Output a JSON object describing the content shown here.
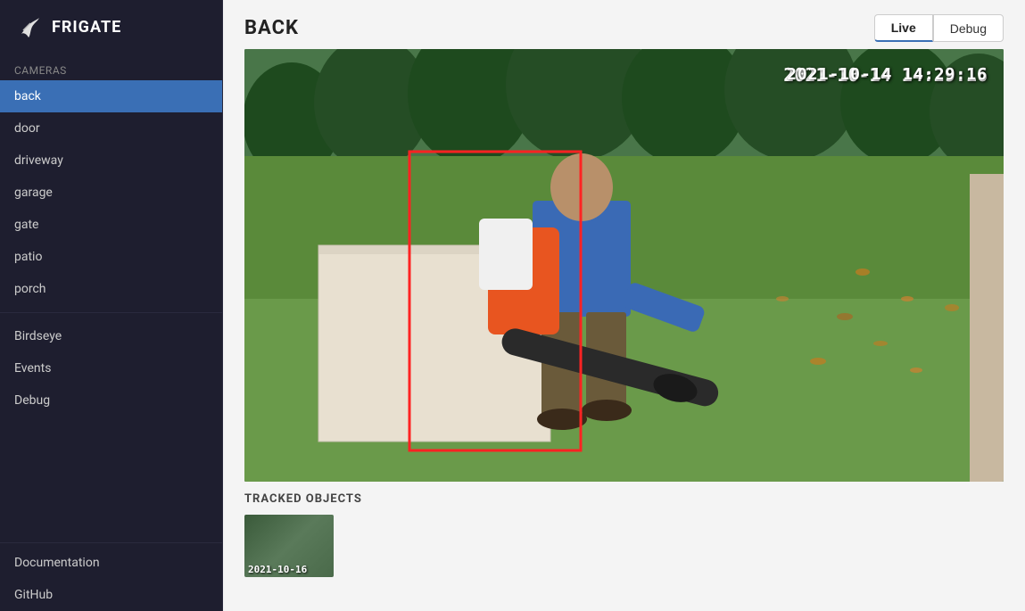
{
  "app": {
    "title": "FRIGATE"
  },
  "sidebar": {
    "cameras_label": "Cameras",
    "items": [
      {
        "id": "back",
        "label": "back",
        "active": true
      },
      {
        "id": "door",
        "label": "door",
        "active": false
      },
      {
        "id": "driveway",
        "label": "driveway",
        "active": false
      },
      {
        "id": "garage",
        "label": "garage",
        "active": false
      },
      {
        "id": "gate",
        "label": "gate",
        "active": false
      },
      {
        "id": "patio",
        "label": "patio",
        "active": false
      },
      {
        "id": "porch",
        "label": "porch",
        "active": false
      }
    ],
    "birdseye_label": "Birdseye",
    "events_label": "Events",
    "debug_label": "Debug",
    "documentation_label": "Documentation",
    "github_label": "GitHub"
  },
  "main": {
    "page_title": "BACK",
    "tabs": [
      {
        "id": "live",
        "label": "Live",
        "active": true
      },
      {
        "id": "debug",
        "label": "Debug",
        "active": false
      }
    ],
    "timestamp": "2021-10-14 14:29:16",
    "tracked_objects_label": "TRACKED OBJECTS",
    "thumbnail_date": "2021-10-16"
  }
}
